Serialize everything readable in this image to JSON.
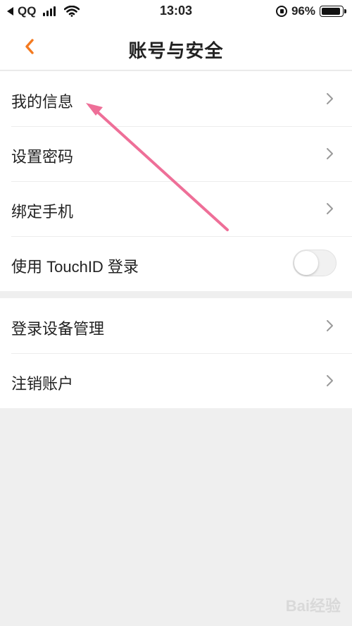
{
  "status_bar": {
    "carrier": "QQ",
    "time": "13:03",
    "battery": "96%",
    "battery_level": 0.96
  },
  "nav": {
    "title": "账号与安全"
  },
  "section1": {
    "items": [
      {
        "label": "我的信息"
      },
      {
        "label": "设置密码"
      },
      {
        "label": "绑定手机"
      },
      {
        "label": "使用 TouchID 登录",
        "toggle": false
      }
    ]
  },
  "section2": {
    "items": [
      {
        "label": "登录设备管理"
      },
      {
        "label": "注销账户"
      }
    ]
  },
  "colors": {
    "accent": "#f47a20",
    "annotation_arrow": "#ee6f98"
  },
  "watermark": "Bai经验"
}
